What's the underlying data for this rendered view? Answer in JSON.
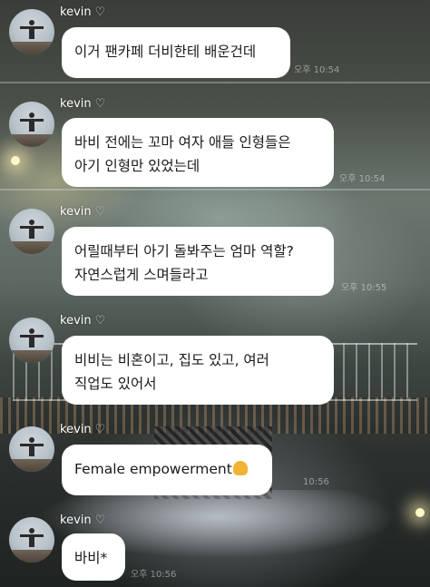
{
  "sender": {
    "name": "kevin",
    "heart_icon": "white-heart-icon"
  },
  "messages": [
    {
      "text": "이거 팬카페 더비한테 배운건데",
      "time": "오후 10:54"
    },
    {
      "line1": "바비 전에는 꼬마 여자 애들 인형들은",
      "line2": "아기 인형만 있었는데",
      "time": "오후 10:54"
    },
    {
      "line1": "어릴때부터 아기 돌봐주는 엄마 역할?",
      "line2": "자연스럽게 스며들라고",
      "time": "오후 10:55"
    },
    {
      "line1": "비비는 비혼이고, 집도 있고, 여러",
      "line2": "직업도 있어서",
      "time": ""
    },
    {
      "text": "Female empowerment",
      "emoji": "flexed-biceps-icon",
      "time": "10:56"
    },
    {
      "text": "바비*",
      "time": "오후 10:56"
    }
  ]
}
